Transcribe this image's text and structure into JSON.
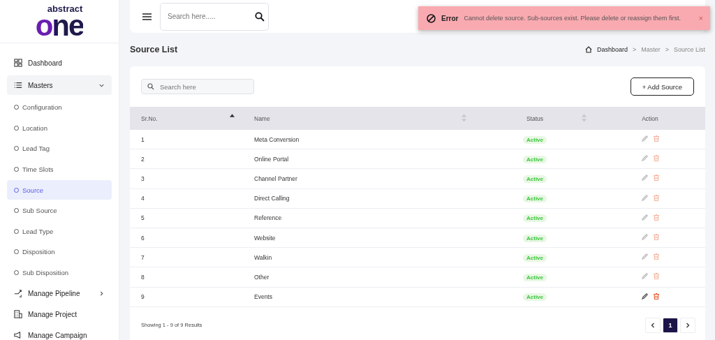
{
  "logo": {
    "top": "abstract",
    "main": "one"
  },
  "sidebar": {
    "items": [
      {
        "label": "Dashboard",
        "kind": "link"
      },
      {
        "label": "Masters",
        "kind": "group",
        "expanded": true,
        "children": [
          {
            "label": "Configuration",
            "selected": false
          },
          {
            "label": "Location",
            "selected": false
          },
          {
            "label": "Lead Tag",
            "selected": false
          },
          {
            "label": "Time Slots",
            "selected": false
          },
          {
            "label": "Source",
            "selected": true
          },
          {
            "label": "Sub Source",
            "selected": false
          },
          {
            "label": "Lead Type",
            "selected": false
          },
          {
            "label": "Disposition",
            "selected": false
          },
          {
            "label": "Sub Disposition",
            "selected": false
          }
        ]
      },
      {
        "label": "Manage Pipeline",
        "kind": "group",
        "expanded": false
      },
      {
        "label": "Manage Project",
        "kind": "link"
      },
      {
        "label": "Manage Campaign",
        "kind": "link"
      }
    ]
  },
  "topbar": {
    "search": {
      "placeholder": "Search here....."
    }
  },
  "toast": {
    "title": "Error",
    "message": "Cannot delete source. Sub-sources exist. Please delete or reassign them first.",
    "close": "×"
  },
  "page": {
    "title": "Source List",
    "breadcrumb": [
      "Dashboard",
      "Master",
      "Source List"
    ],
    "separator": ">"
  },
  "toolbar": {
    "search": {
      "placeholder": "Search here"
    },
    "add_button": "+ Add Source"
  },
  "table": {
    "columns": [
      {
        "label": "Sr.No.",
        "sortable": true,
        "sorted": true
      },
      {
        "label": "Name",
        "sortable": true,
        "sorted": false
      },
      {
        "label": "Status",
        "sortable": true,
        "sorted": false
      },
      {
        "label": "Action",
        "sortable": false
      }
    ],
    "rows": [
      {
        "no": "1",
        "name": "Meta Conversion",
        "status": "Active",
        "hovered": false
      },
      {
        "no": "2",
        "name": "Online Portal",
        "status": "Active",
        "hovered": false
      },
      {
        "no": "3",
        "name": "Channel Partner",
        "status": "Active",
        "hovered": false
      },
      {
        "no": "4",
        "name": "Direct Calling",
        "status": "Active",
        "hovered": false
      },
      {
        "no": "5",
        "name": "Reference",
        "status": "Active",
        "hovered": false
      },
      {
        "no": "6",
        "name": "Website",
        "status": "Active",
        "hovered": false
      },
      {
        "no": "7",
        "name": "Walkin",
        "status": "Active",
        "hovered": false
      },
      {
        "no": "8",
        "name": "Other",
        "status": "Active",
        "hovered": false
      },
      {
        "no": "9",
        "name": "Events",
        "status": "Active",
        "hovered": true
      }
    ]
  },
  "footer": {
    "summary": "Showing 1 - 9 of 9 Results",
    "pages": [
      {
        "label": "1",
        "selected": true
      }
    ]
  }
}
